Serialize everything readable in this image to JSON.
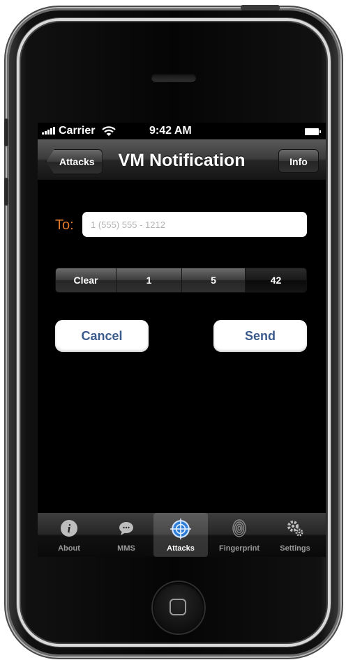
{
  "status_bar": {
    "carrier": "Carrier",
    "time": "9:42 AM"
  },
  "nav_bar": {
    "back_label": "Attacks",
    "title": "VM Notification",
    "info_label": "Info"
  },
  "form": {
    "to_label": "To:",
    "to_placeholder": "1 (555) 555 - 1212",
    "to_value": ""
  },
  "segmented_control": {
    "segments": [
      "Clear",
      "1",
      "5",
      "42"
    ],
    "selected": "42"
  },
  "buttons": {
    "cancel_label": "Cancel",
    "send_label": "Send"
  },
  "tab_bar": {
    "items": [
      {
        "label": "About",
        "icon": "info-icon"
      },
      {
        "label": "MMS",
        "icon": "chat-bubble-icon"
      },
      {
        "label": "Attacks",
        "icon": "target-icon"
      },
      {
        "label": "Fingerprint",
        "icon": "fingerprint-icon"
      },
      {
        "label": "Settings",
        "icon": "gears-icon"
      }
    ],
    "active": "Attacks"
  },
  "colors": {
    "accent_orange": "#e27a2a",
    "button_text_blue": "#3b5a8c",
    "active_tab_blue": "#2f7fd8"
  }
}
